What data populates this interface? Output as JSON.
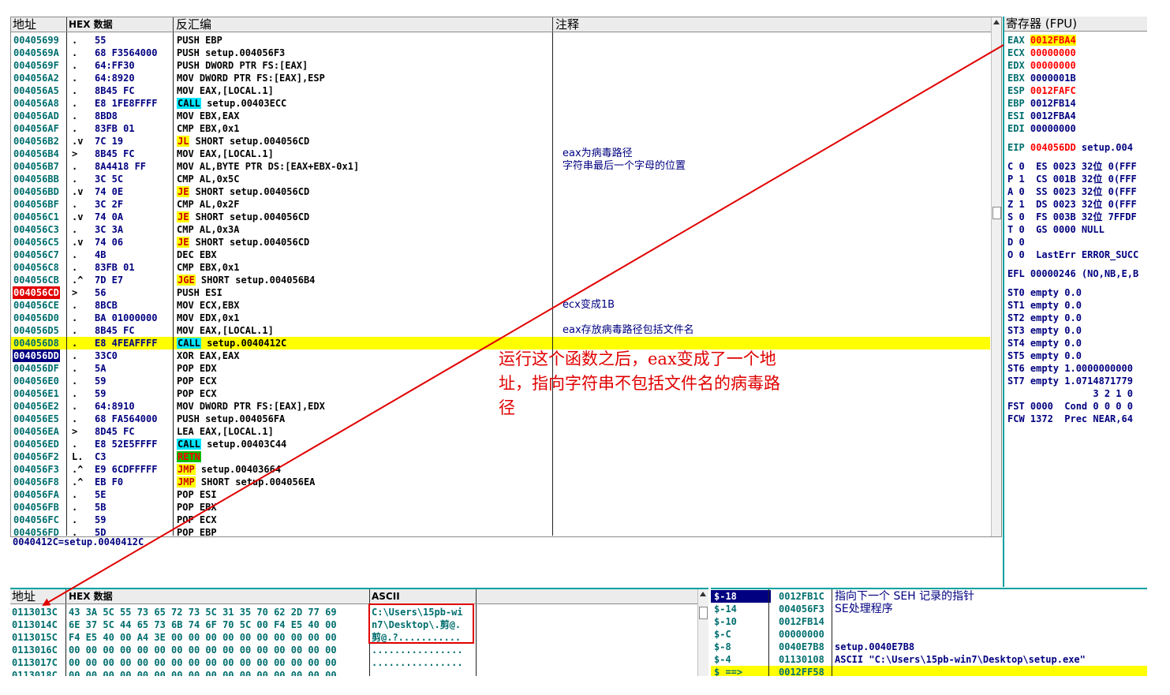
{
  "cpu": {
    "headers": {
      "addr": "地址",
      "hex": "HEX 数据",
      "disasm": "反汇编",
      "comment": "注释"
    },
    "rows": [
      {
        "addr": "00405699",
        "mark": ".",
        "hex": "55",
        "dis": [
          {
            "t": "PUSH EBP"
          }
        ]
      },
      {
        "addr": "0040569A",
        "mark": ".",
        "hex": "68 F3564000",
        "dis": [
          {
            "t": "PUSH setup.004056F3"
          }
        ]
      },
      {
        "addr": "0040569F",
        "mark": ".",
        "hex": "64:FF30",
        "dis": [
          {
            "t": "PUSH DWORD PTR FS:[EAX]"
          }
        ]
      },
      {
        "addr": "004056A2",
        "mark": ".",
        "hex": "64:8920",
        "dis": [
          {
            "t": "MOV DWORD PTR FS:[EAX],ESP"
          }
        ]
      },
      {
        "addr": "004056A5",
        "mark": ".",
        "hex": "8B45 FC",
        "dis": [
          {
            "t": "MOV EAX,[LOCAL.1]"
          }
        ]
      },
      {
        "addr": "004056A8",
        "mark": ".",
        "hex": "E8 1FE8FFFF",
        "dis": [
          {
            "kw": "CALL",
            "c": "call"
          },
          {
            "t": " setup.00403ECC"
          }
        ]
      },
      {
        "addr": "004056AD",
        "mark": ".",
        "hex": "8BD8",
        "dis": [
          {
            "t": "MOV EBX,EAX"
          }
        ]
      },
      {
        "addr": "004056AF",
        "mark": ".",
        "hex": "83FB 01",
        "dis": [
          {
            "t": "CMP EBX,0x1"
          }
        ]
      },
      {
        "addr": "004056B2",
        "mark": ".v",
        "hex": "7C 19",
        "dis": [
          {
            "kw": "JL",
            "c": "jmp"
          },
          {
            "t": " SHORT setup.004056CD"
          }
        ]
      },
      {
        "addr": "004056B4",
        "mark": ">",
        "hex": "8B45 FC",
        "dis": [
          {
            "t": "MOV EAX,[LOCAL.1]"
          }
        ],
        "cmt": "eax为病毒路径"
      },
      {
        "addr": "004056B7",
        "mark": ".",
        "hex": "8A4418 FF",
        "dis": [
          {
            "t": "MOV AL,BYTE PTR DS:[EAX+EBX-0x1]"
          }
        ],
        "cmt": "字符串最后一个字母的位置"
      },
      {
        "addr": "004056BB",
        "mark": ".",
        "hex": "3C 5C",
        "dis": [
          {
            "t": "CMP AL,0x5C"
          }
        ]
      },
      {
        "addr": "004056BD",
        "mark": ".v",
        "hex": "74 0E",
        "dis": [
          {
            "kw": "JE",
            "c": "jmp"
          },
          {
            "t": " SHORT setup.004056CD"
          }
        ]
      },
      {
        "addr": "004056BF",
        "mark": ".",
        "hex": "3C 2F",
        "dis": [
          {
            "t": "CMP AL,0x2F"
          }
        ]
      },
      {
        "addr": "004056C1",
        "mark": ".v",
        "hex": "74 0A",
        "dis": [
          {
            "kw": "JE",
            "c": "jmp"
          },
          {
            "t": " SHORT setup.004056CD"
          }
        ]
      },
      {
        "addr": "004056C3",
        "mark": ".",
        "hex": "3C 3A",
        "dis": [
          {
            "t": "CMP AL,0x3A"
          }
        ]
      },
      {
        "addr": "004056C5",
        "mark": ".v",
        "hex": "74 06",
        "dis": [
          {
            "kw": "JE",
            "c": "jmp"
          },
          {
            "t": " SHORT setup.004056CD"
          }
        ]
      },
      {
        "addr": "004056C7",
        "mark": ".",
        "hex": "4B",
        "dis": [
          {
            "t": "DEC EBX"
          }
        ]
      },
      {
        "addr": "004056C8",
        "mark": ".",
        "hex": "83FB 01",
        "dis": [
          {
            "t": "CMP EBX,0x1"
          }
        ]
      },
      {
        "addr": "004056CB",
        "mark": ".^",
        "hex": "7D E7",
        "dis": [
          {
            "kw": "JGE",
            "c": "jmp"
          },
          {
            "t": " SHORT setup.004056B4"
          }
        ]
      },
      {
        "addr": "004056CD",
        "mark": ">",
        "hex": "56",
        "dis": [
          {
            "t": "PUSH ESI"
          }
        ],
        "sel": "red"
      },
      {
        "addr": "004056CE",
        "mark": ".",
        "hex": "8BCB",
        "dis": [
          {
            "t": "MOV ECX,EBX"
          }
        ],
        "cmt": "ecx变成1B"
      },
      {
        "addr": "004056D0",
        "mark": ".",
        "hex": "BA 01000000",
        "dis": [
          {
            "t": "MOV EDX,0x1"
          }
        ]
      },
      {
        "addr": "004056D5",
        "mark": ".",
        "hex": "8B45 FC",
        "dis": [
          {
            "t": "MOV EAX,[LOCAL.1]"
          }
        ],
        "cmt": "eax存放病毒路径包括文件名"
      },
      {
        "addr": "004056D8",
        "mark": ".",
        "hex": "E8 4FEAFFFF",
        "dis": [
          {
            "kw": "CALL",
            "c": "call"
          },
          {
            "t": " setup.0040412C"
          }
        ],
        "hl": true
      },
      {
        "addr": "004056DD",
        "mark": ".",
        "hex": "33C0",
        "dis": [
          {
            "t": "XOR EAX,EAX"
          }
        ],
        "sel": "blue"
      },
      {
        "addr": "004056DF",
        "mark": ".",
        "hex": "5A",
        "dis": [
          {
            "t": "POP EDX"
          }
        ]
      },
      {
        "addr": "004056E0",
        "mark": ".",
        "hex": "59",
        "dis": [
          {
            "t": "POP ECX"
          }
        ]
      },
      {
        "addr": "004056E1",
        "mark": ".",
        "hex": "59",
        "dis": [
          {
            "t": "POP ECX"
          }
        ]
      },
      {
        "addr": "004056E2",
        "mark": ".",
        "hex": "64:8910",
        "dis": [
          {
            "t": "MOV DWORD PTR FS:[EAX],EDX"
          }
        ]
      },
      {
        "addr": "004056E5",
        "mark": ".",
        "hex": "68 FA564000",
        "dis": [
          {
            "t": "PUSH setup.004056FA"
          }
        ]
      },
      {
        "addr": "004056EA",
        "mark": ">",
        "hex": "8D45 FC",
        "dis": [
          {
            "t": "LEA EAX,[LOCAL.1]"
          }
        ]
      },
      {
        "addr": "004056ED",
        "mark": ".",
        "hex": "E8 52E5FFFF",
        "dis": [
          {
            "kw": "CALL",
            "c": "call"
          },
          {
            "t": " setup.00403C44"
          }
        ]
      },
      {
        "addr": "004056F2",
        "mark": "L.",
        "hex": "C3",
        "dis": [
          {
            "kw": "RETN",
            "c": "retn"
          }
        ]
      },
      {
        "addr": "004056F3",
        "mark": ".^",
        "hex": "E9 6CDFFFFF",
        "dis": [
          {
            "kw": "JMP",
            "c": "jmp"
          },
          {
            "t": " setup.00403664"
          }
        ]
      },
      {
        "addr": "004056F8",
        "mark": ".^",
        "hex": "EB F0",
        "dis": [
          {
            "kw": "JMP",
            "c": "jmp"
          },
          {
            "t": " SHORT setup.004056EA"
          }
        ]
      },
      {
        "addr": "004056FA",
        "mark": ".",
        "hex": "5E",
        "dis": [
          {
            "t": "POP ESI"
          }
        ]
      },
      {
        "addr": "004056FB",
        "mark": ".",
        "hex": "5B",
        "dis": [
          {
            "t": "POP EBX"
          }
        ]
      },
      {
        "addr": "004056FC",
        "mark": ".",
        "hex": "59",
        "dis": [
          {
            "t": "POP ECX"
          }
        ]
      },
      {
        "addr": "004056FD",
        "mark": ".",
        "hex": "5D",
        "dis": [
          {
            "t": "POP EBP"
          }
        ]
      }
    ],
    "info_line": "0040412C=setup.0040412C"
  },
  "registers": {
    "header": "寄存器 (FPU)",
    "lines": [
      {
        "segs": [
          {
            "t": "EAX ",
            "c": "reg"
          },
          {
            "t": "0012FBA4",
            "c": "regyel"
          }
        ]
      },
      {
        "segs": [
          {
            "t": "ECX ",
            "c": "reg"
          },
          {
            "t": "00000000",
            "c": "regred"
          }
        ]
      },
      {
        "segs": [
          {
            "t": "EDX ",
            "c": "reg"
          },
          {
            "t": "00000000",
            "c": "regred"
          }
        ]
      },
      {
        "segs": [
          {
            "t": "EBX ",
            "c": "reg"
          },
          {
            "t": "0000001B",
            "c": "regv"
          }
        ]
      },
      {
        "segs": [
          {
            "t": "ESP ",
            "c": "reg"
          },
          {
            "t": "0012FAFC",
            "c": "regred"
          }
        ]
      },
      {
        "segs": [
          {
            "t": "EBP ",
            "c": "reg"
          },
          {
            "t": "0012FB14",
            "c": "regv"
          }
        ]
      },
      {
        "segs": [
          {
            "t": "ESI ",
            "c": "reg"
          },
          {
            "t": "0012FBA4",
            "c": "regv"
          }
        ]
      },
      {
        "segs": [
          {
            "t": "EDI ",
            "c": "reg"
          },
          {
            "t": "00000000",
            "c": "regv"
          }
        ]
      },
      {
        "segs": [
          {
            "t": "",
            "c": "reg"
          }
        ]
      },
      {
        "segs": [
          {
            "t": "EIP ",
            "c": "reg"
          },
          {
            "t": "004056DD",
            "c": "regred"
          },
          {
            "t": " setup.004",
            "c": "regv"
          }
        ]
      },
      {
        "segs": [
          {
            "t": "",
            "c": "reg"
          }
        ]
      },
      {
        "segs": [
          {
            "t": "C 0  ES 0023 32位 0(FFF",
            "c": "regv"
          }
        ]
      },
      {
        "segs": [
          {
            "t": "P 1  CS 001B 32位 0(FFF",
            "c": "regv"
          }
        ]
      },
      {
        "segs": [
          {
            "t": "A 0  SS 0023 32位 0(FFF",
            "c": "regv"
          }
        ]
      },
      {
        "segs": [
          {
            "t": "Z 1  DS 0023 32位 0(FFF",
            "c": "regv"
          }
        ]
      },
      {
        "segs": [
          {
            "t": "S 0  FS 003B 32位 7FFDF",
            "c": "regv"
          }
        ]
      },
      {
        "segs": [
          {
            "t": "T 0  GS 0000 NULL",
            "c": "regv"
          }
        ]
      },
      {
        "segs": [
          {
            "t": "D 0",
            "c": "regv"
          }
        ]
      },
      {
        "segs": [
          {
            "t": "O 0  LastErr ERROR_SUCC",
            "c": "regv"
          }
        ]
      },
      {
        "segs": [
          {
            "t": "",
            "c": "reg"
          }
        ]
      },
      {
        "segs": [
          {
            "t": "EFL 00000246 (NO,NB,E,B",
            "c": "regv"
          }
        ]
      },
      {
        "segs": [
          {
            "t": "",
            "c": "reg"
          }
        ]
      },
      {
        "segs": [
          {
            "t": "ST0 empty 0.0",
            "c": "regv"
          }
        ]
      },
      {
        "segs": [
          {
            "t": "ST1 empty 0.0",
            "c": "regv"
          }
        ]
      },
      {
        "segs": [
          {
            "t": "ST2 empty 0.0",
            "c": "regv"
          }
        ]
      },
      {
        "segs": [
          {
            "t": "ST3 empty 0.0",
            "c": "regv"
          }
        ]
      },
      {
        "segs": [
          {
            "t": "ST4 empty 0.0",
            "c": "regv"
          }
        ]
      },
      {
        "segs": [
          {
            "t": "ST5 empty 0.0",
            "c": "regv"
          }
        ]
      },
      {
        "segs": [
          {
            "t": "ST6 empty 1.0000000000",
            "c": "regv"
          }
        ]
      },
      {
        "segs": [
          {
            "t": "ST7 empty 1.0714871779",
            "c": "regv"
          }
        ]
      },
      {
        "segs": [
          {
            "t": "               3 2 1 0",
            "c": "regv"
          }
        ]
      },
      {
        "segs": [
          {
            "t": "FST 0000  Cond 0 0 0 0",
            "c": "regv"
          }
        ]
      },
      {
        "segs": [
          {
            "t": "FCW 1372  Prec NEAR,64",
            "c": "regv"
          }
        ]
      }
    ]
  },
  "dump": {
    "headers": {
      "addr": "地址",
      "hex": "HEX 数据",
      "ascii": "ASCII"
    },
    "rows": [
      {
        "addr": "0113013C",
        "hex": "43 3A 5C 55 73 65 72 73 5C 31 35 70 62 2D 77 69",
        "ascii": "C:\\Users\\15pb-wi"
      },
      {
        "addr": "0113014C",
        "hex": "6E 37 5C 44 65 73 6B 74 6F 70 5C 00 F4 E5 40 00",
        "ascii": "n7\\Desktop\\.剪@."
      },
      {
        "addr": "0113015C",
        "hex": "F4 E5 40 00 A4 3E 00 00 00 00 00 00 00 00 00 00",
        "ascii": "剪@.?..........."
      },
      {
        "addr": "0113016C",
        "hex": "00 00 00 00 00 00 00 00 00 00 00 00 00 00 00 00",
        "ascii": "................"
      },
      {
        "addr": "0113017C",
        "hex": "00 00 00 00 00 00 00 00 00 00 00 00 00 00 00 00",
        "ascii": "................"
      },
      {
        "addr": "0113018C",
        "hex": "00 00 00 00 00 00 00 00 00 00 00 00 00 00 00 00",
        "ascii": "................"
      }
    ]
  },
  "stack": {
    "rows": [
      {
        "label": "$-18",
        "addr": "0012FB1C",
        "value": "",
        "cmt": "指向下一个 SEH 记录的指针",
        "sel": "dark"
      },
      {
        "label": "$-14",
        "addr": "004056F3",
        "value": "",
        "cmt": "SE处理程序"
      },
      {
        "label": "$-10",
        "addr": "0012FB14",
        "value": "",
        "cmt": ""
      },
      {
        "label": "$-C",
        "addr": "00000000",
        "value": "",
        "cmt": ""
      },
      {
        "label": "$-8",
        "addr": "0040E7B8",
        "value": "setup.0040E7B8",
        "cmt": ""
      },
      {
        "label": "$-4",
        "addr": "01130108",
        "value": "ASCII \"C:\\Users\\15pb-win7\\Desktop\\setup.exe\"",
        "cmt": ""
      },
      {
        "label": "$ ==>",
        "addr": "0012FF58",
        "value": "",
        "cmt": "",
        "hl": true
      }
    ]
  },
  "annotation": {
    "text": "运行这个函数之后，eax变成了一个地址，指向字符串不包括文件名的病毒路径"
  }
}
